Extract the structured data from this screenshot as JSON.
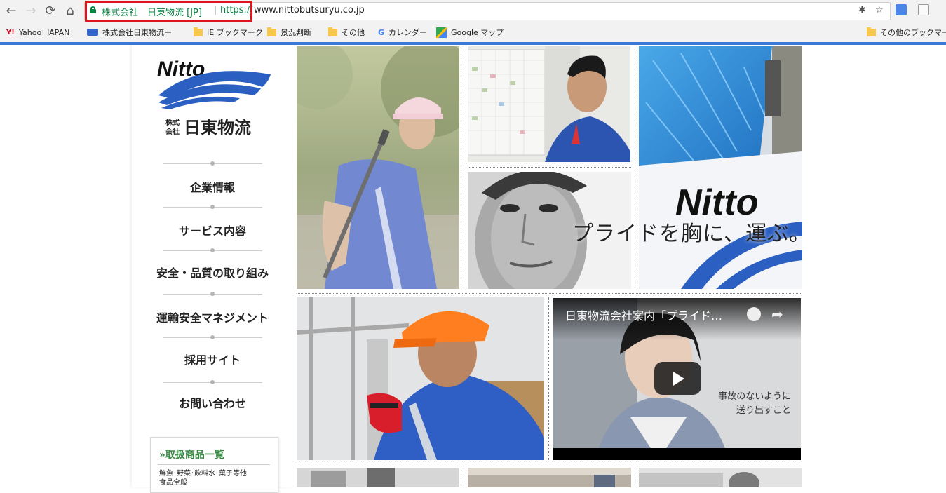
{
  "browser": {
    "security_label": "株式会社　日東物流 [JP]",
    "separator": "|",
    "scheme": "https://",
    "host": "www.nittobutsuryu.co.jp",
    "back_icon": "arrow-left",
    "forward_icon": "arrow-right",
    "reload_icon": "reload",
    "home_icon": "home",
    "lock_color": "#0b8043",
    "highlight_color": "#e0141e"
  },
  "bookmarks": {
    "items": [
      {
        "label": "Yahoo! JAPAN",
        "icon": "yahoo-icon"
      },
      {
        "label": "株式会社日東物流ー",
        "icon": "site-icon"
      },
      {
        "label": "IE ブックマーク",
        "icon": "folder-icon"
      },
      {
        "label": "景況判断",
        "icon": "folder-icon"
      },
      {
        "label": "その他",
        "icon": "folder-icon"
      },
      {
        "label": "カレンダー",
        "icon": "google-icon"
      },
      {
        "label": "Google マップ",
        "icon": "maps-icon"
      }
    ],
    "other": "その他のブックマーク"
  },
  "logo": {
    "wordmark": "Nitto",
    "small": "株式\n会社",
    "company": "日東物流"
  },
  "menu": {
    "items": [
      "企業情報",
      "サービス内容",
      "安全・品質の取り組み",
      "運輸安全マネジメント",
      "採用サイト",
      "お問い合わせ"
    ]
  },
  "products": {
    "title": "»取扱商品一覧",
    "text1": "鮮魚･野菜･飲料水･菓子等他",
    "text2": "食品全般"
  },
  "hero": {
    "tagline": "プライドを胸に、運ぶ。",
    "truck_text": "Nitto"
  },
  "video": {
    "title": "日東物流会社案内「プライド…",
    "caption1": "事故のないように",
    "caption2": "送り出すこと"
  }
}
